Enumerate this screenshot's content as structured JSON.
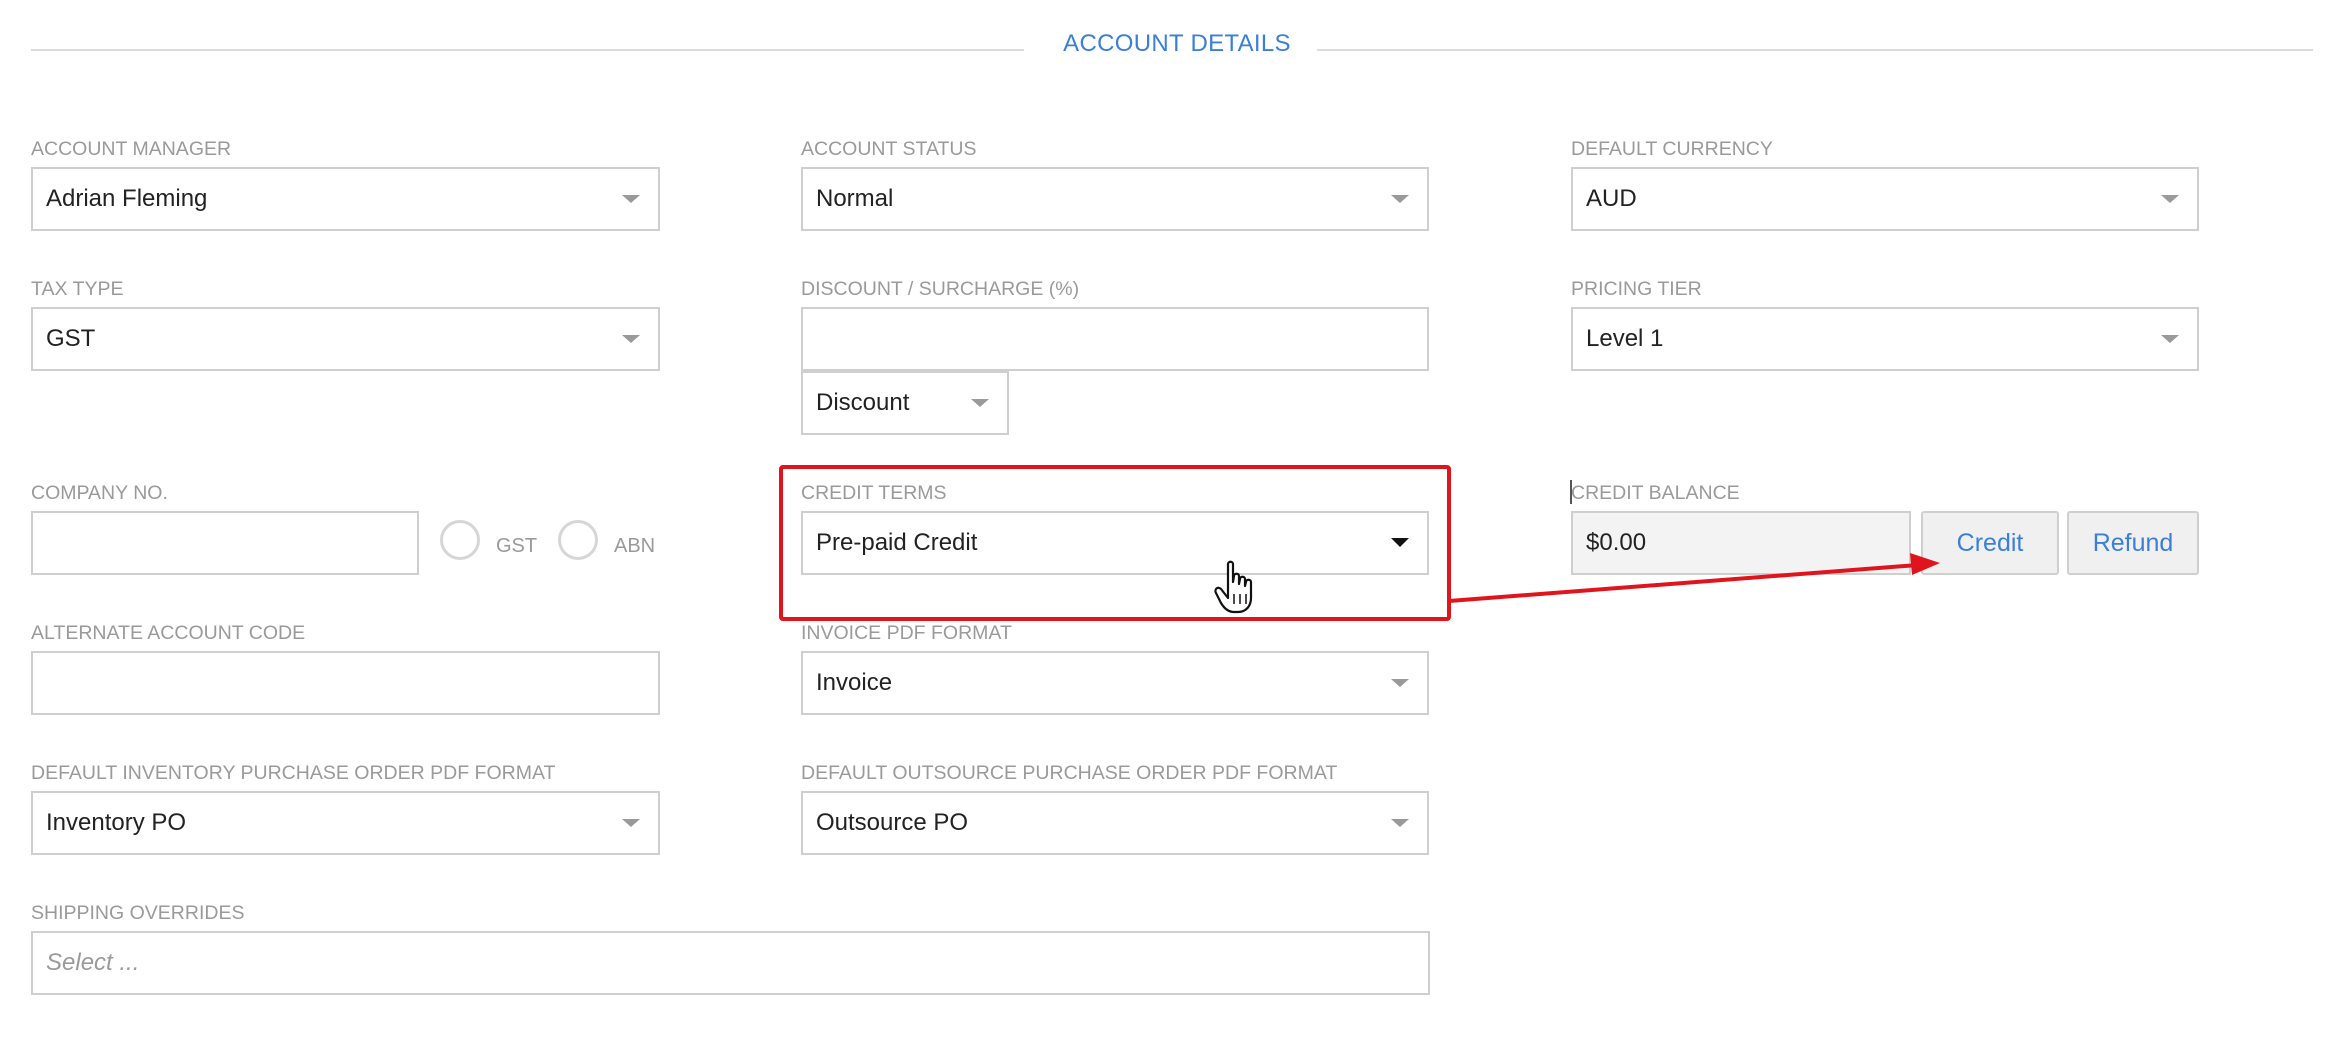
{
  "section": {
    "title": "ACCOUNT DETAILS"
  },
  "account_manager": {
    "label": "ACCOUNT MANAGER",
    "value": "Adrian Fleming"
  },
  "account_status": {
    "label": "ACCOUNT STATUS",
    "value": "Normal"
  },
  "default_currency": {
    "label": "DEFAULT CURRENCY",
    "value": "AUD"
  },
  "tax_type": {
    "label": "TAX TYPE",
    "value": "GST"
  },
  "discount_surcharge": {
    "label": "DISCOUNT / SURCHARGE (%)",
    "value": "",
    "mode": "Discount"
  },
  "pricing_tier": {
    "label": "PRICING TIER",
    "value": "Level 1"
  },
  "company_no": {
    "label": "COMPANY NO.",
    "value": "",
    "radio_gst": "GST",
    "radio_abn": "ABN"
  },
  "credit_terms": {
    "label": "CREDIT TERMS",
    "value": "Pre-paid Credit"
  },
  "credit_balance": {
    "label": "CREDIT BALANCE",
    "value": "$0.00",
    "credit_button": "Credit",
    "refund_button": "Refund"
  },
  "alternate_account_code": {
    "label": "ALTERNATE ACCOUNT CODE",
    "value": ""
  },
  "invoice_pdf_format": {
    "label": "INVOICE PDF FORMAT",
    "value": "Invoice"
  },
  "default_inventory_po_format": {
    "label": "DEFAULT INVENTORY PURCHASE ORDER PDF FORMAT",
    "value": "Inventory PO"
  },
  "default_outsource_po_format": {
    "label": "DEFAULT OUTSOURCE PURCHASE ORDER PDF FORMAT",
    "value": "Outsource PO"
  },
  "shipping_overrides": {
    "label": "SHIPPING OVERRIDES",
    "placeholder": "Select ..."
  },
  "annotation": {
    "highlight_color": "#e0141c",
    "link_color": "#3a7fd8"
  }
}
